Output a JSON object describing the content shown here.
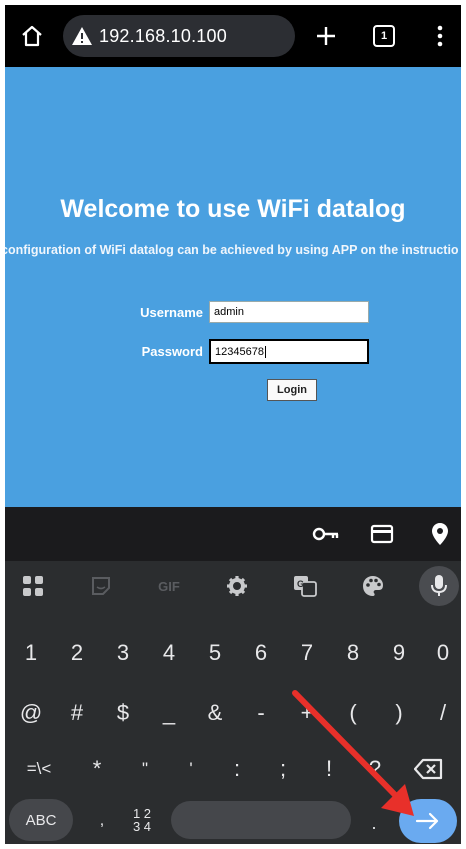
{
  "browser": {
    "url": "192.168.10.100",
    "tab_count": "1",
    "icons": [
      "home-icon",
      "warning-icon",
      "plus-icon",
      "tab-switcher-icon",
      "overflow-menu-icon"
    ]
  },
  "page": {
    "background": "#4aa0e0",
    "title": "Welcome to use WiFi datalog",
    "subtitle": "configuration of WiFi datalog can be achieved by using APP on the instructio",
    "username_label": "Username",
    "username_value": "admin",
    "password_label": "Password",
    "password_value": "12345678",
    "login_label": "Login"
  },
  "autofill_bar": {
    "icons": [
      "key-icon",
      "credit-card-icon",
      "location-pin-icon"
    ]
  },
  "keyboard": {
    "toolbar_icons": [
      "apps-grid-icon",
      "sticker-icon",
      "gif-icon",
      "settings-icon",
      "translate-icon",
      "palette-icon",
      "mic-icon"
    ],
    "gif_label": "GIF",
    "number_row": [
      "1",
      "2",
      "3",
      "4",
      "5",
      "6",
      "7",
      "8",
      "9",
      "0"
    ],
    "symbol_row": [
      "@",
      "#",
      "$",
      "_",
      "&",
      "-",
      "+",
      "(",
      ")",
      "/"
    ],
    "symbol_row2": [
      "=\\<",
      "*",
      "\"",
      "'",
      ":",
      ";",
      "!",
      "?"
    ],
    "abc_label": "ABC",
    "comma_label": ",",
    "numpad_label_top": "1 2",
    "numpad_label_bottom": "3 4",
    "period_label": "."
  },
  "colors": {
    "accent_enter": "#6aaaf0",
    "annotation_arrow": "#e8302a"
  }
}
